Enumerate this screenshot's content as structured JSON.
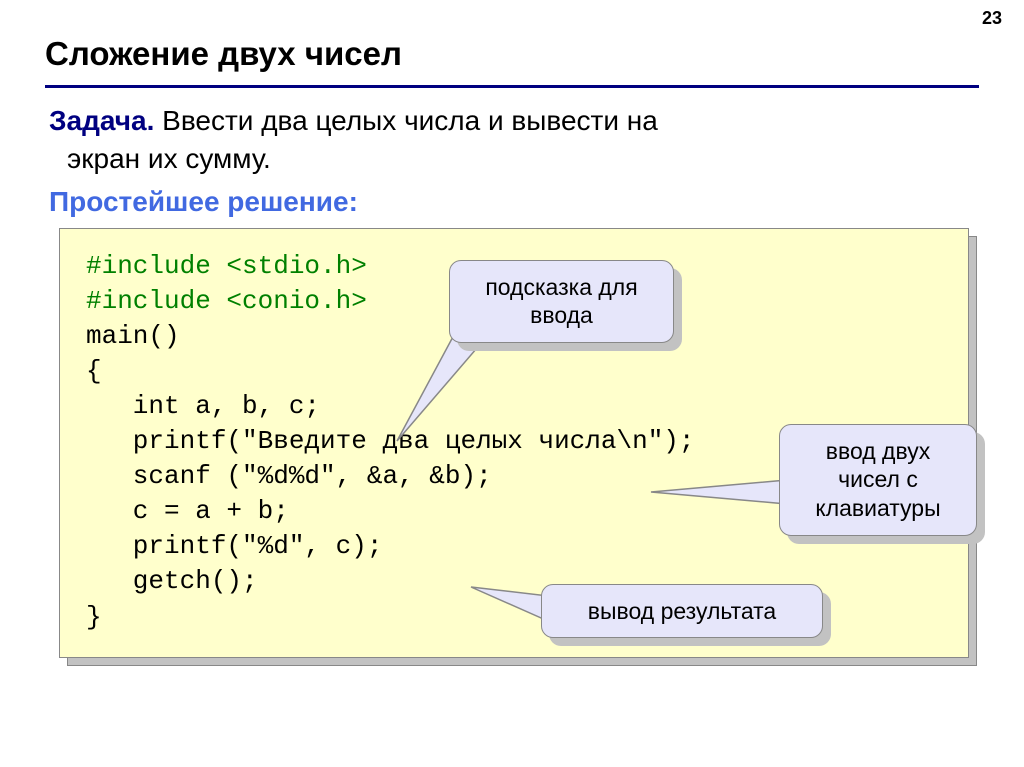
{
  "page_number": "23",
  "title": "Сложение двух чисел",
  "task": {
    "label": "Задача.",
    "text_line1": " Ввести два целых числа и вывести на",
    "text_line2": "экран их сумму."
  },
  "solution_heading": "Простейшее решение:",
  "code": {
    "l1": "#include <stdio.h>",
    "l2": "#include <conio.h>",
    "l3": "main()",
    "l4": "{",
    "l5": "   int a, b, c;",
    "l6": "   printf(\"Введите два целых числа\\n\");",
    "l7": "   scanf (\"%d%d\", &a, &b);",
    "l8": "   c = a + b;",
    "l9": "   printf(\"%d\", c);",
    "l10": "   getch();",
    "l11": "}"
  },
  "callouts": {
    "c1_line1": "подсказка для",
    "c1_line2": "ввода",
    "c2_line1": "ввод двух",
    "c2_line2": "чисел с",
    "c2_line3": "клавиатуры",
    "c3": "вывод результата"
  }
}
